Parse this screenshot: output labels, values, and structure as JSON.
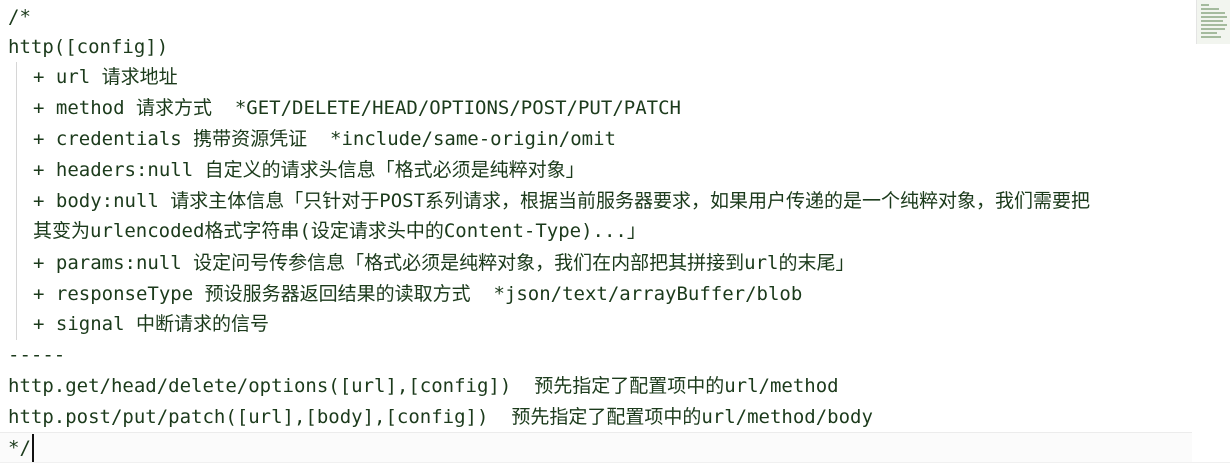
{
  "editor": {
    "lines": [
      "/*",
      "http([config])",
      "+ url 请求地址",
      "+ method 请求方式  *GET/DELETE/HEAD/OPTIONS/POST/PUT/PATCH",
      "+ credentials 携带资源凭证  *include/same-origin/omit",
      "+ headers:null 自定义的请求头信息「格式必须是纯粹对象」",
      "+ body:null 请求主体信息「只针对于POST系列请求，根据当前服务器要求，如果用户传递的是一个纯粹对象，我们需要把",
      "其变为urlencoded格式字符串(设定请求头中的Content-Type)...」",
      "+ params:null 设定问号传参信息「格式必须是纯粹对象，我们在内部把其拼接到url的末尾」",
      "+ responseType 预设服务器返回结果的读取方式  *json/text/arrayBuffer/blob",
      "+ signal 中断请求的信号",
      "-----",
      "http.get/head/delete/options([url],[config])  预先指定了配置项中的url/method",
      "http.post/put/patch([url],[body],[config])  预先指定了配置项中的url/method/body",
      "*/"
    ]
  },
  "colors": {
    "text": "#1b3a1b",
    "background": "#ffffff",
    "cursor": "#111111"
  }
}
